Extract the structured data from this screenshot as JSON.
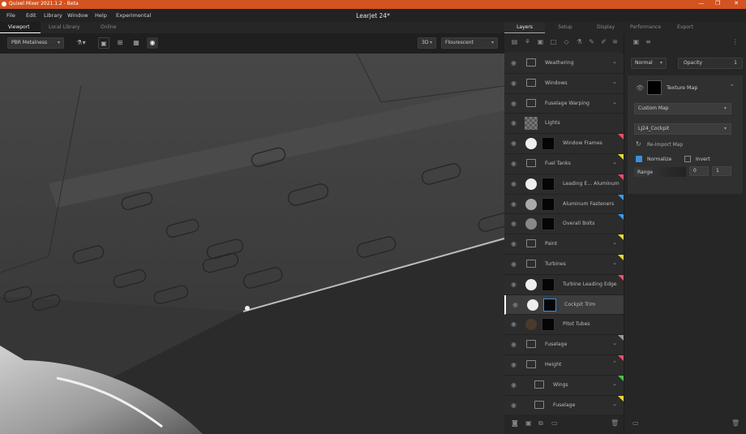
{
  "window": {
    "title": "Quixel Mixer 2021.1.2 - Beta",
    "document_title": "Learjet 24*",
    "controls": [
      "—",
      "❐",
      "✕"
    ]
  },
  "menu": [
    "File",
    "Edit",
    "Library",
    "Window",
    "Help",
    "Experimental"
  ],
  "left_tabs": [
    "Viewport",
    "Local Library",
    "Online"
  ],
  "viewport_toolbar": {
    "material_mode": "PBR Metalness",
    "view_mode": "3D",
    "lighting": "Flourescent"
  },
  "right_tabs": [
    "Layers",
    "Setup",
    "Display",
    "Performance",
    "Export"
  ],
  "layers": [
    {
      "label": "Weathering",
      "kind": "folder",
      "indent": 0,
      "chev": "⌄",
      "tag": ""
    },
    {
      "label": "Windows",
      "kind": "folder",
      "indent": 0,
      "chev": "⌄",
      "tag": ""
    },
    {
      "label": "Fuselage Warping",
      "kind": "folder",
      "indent": 0,
      "chev": "⌄",
      "tag": ""
    },
    {
      "label": "Lights",
      "kind": "checker",
      "indent": 0,
      "chev": "",
      "tag": ""
    },
    {
      "label": "Window Frames",
      "kind": "mask",
      "indent": 0,
      "chev": "",
      "tag": "#e8506a"
    },
    {
      "label": "Fuel Tanks",
      "kind": "folder",
      "indent": 0,
      "chev": "⌄",
      "tag": "#e8d83a"
    },
    {
      "label": "Leading E... Aluminum",
      "kind": "mask",
      "indent": 0,
      "chev": "",
      "tag": "#e8506a"
    },
    {
      "label": "Aluminum Fasteners",
      "kind": "mask-grey",
      "indent": 0,
      "chev": "",
      "tag": "#3a9ae8"
    },
    {
      "label": "Overall Bolts",
      "kind": "mask-dgrey",
      "indent": 0,
      "chev": "",
      "tag": "#3a9ae8"
    },
    {
      "label": "Paint",
      "kind": "folder",
      "indent": 0,
      "chev": "⌄",
      "tag": "#e8d83a"
    },
    {
      "label": "Turbines",
      "kind": "folder",
      "indent": 0,
      "chev": "⌄",
      "tag": "#e8d83a"
    },
    {
      "label": "Turbine Leading Edge",
      "kind": "mask",
      "indent": 0,
      "chev": "",
      "tag": "#e8506a"
    },
    {
      "label": "Cockpit Trim",
      "kind": "mask-sel",
      "indent": 0,
      "chev": "",
      "tag": "",
      "selected": true
    },
    {
      "label": "Pitot Tubes",
      "kind": "mask-brown",
      "indent": 0,
      "chev": "",
      "tag": ""
    },
    {
      "label": "Fuselage",
      "kind": "folder",
      "indent": 0,
      "chev": "⌄",
      "tag": "#999999"
    },
    {
      "label": "Height",
      "kind": "folder",
      "indent": 0,
      "chev": "⌃",
      "tag": "#e8506a"
    },
    {
      "label": "Wings",
      "kind": "folder",
      "indent": 1,
      "chev": "⌄",
      "tag": "#4ac04a"
    },
    {
      "label": "Fuselage",
      "kind": "folder",
      "indent": 1,
      "chev": "⌄",
      "tag": "#e8d83a"
    }
  ],
  "properties": {
    "blend_mode": "Normal",
    "opacity_label": "Opacity",
    "opacity_value": "1",
    "card_title": "Texture Map",
    "map_type": "Custom Map",
    "map_name": "LJ24_Cockpit",
    "reimport": "Re-Import Map",
    "normalize": "Normalize",
    "invert": "Invert",
    "range_label": "Range",
    "range_min": "0",
    "range_max": "1"
  }
}
